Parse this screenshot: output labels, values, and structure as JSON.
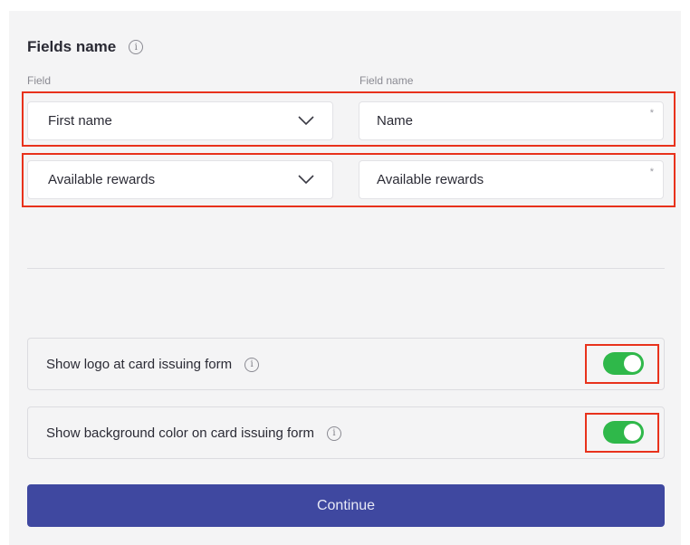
{
  "section": {
    "title": "Fields name",
    "info_icon": "info-icon"
  },
  "columns": {
    "field": "Field",
    "field_name": "Field name"
  },
  "rows": [
    {
      "field": "First name",
      "field_name": "Name",
      "required_mark": "*"
    },
    {
      "field": "Available rewards",
      "field_name": "Available rewards",
      "required_mark": "*"
    }
  ],
  "toggles": [
    {
      "label": "Show logo at card issuing form",
      "on": true
    },
    {
      "label": "Show background color on card issuing form",
      "on": true
    }
  ],
  "continue_label": "Continue",
  "colors": {
    "accent": "#3f48a0",
    "toggle_on": "#2fb84a",
    "highlight": "#e8321c",
    "panel": "#f4f4f5"
  }
}
